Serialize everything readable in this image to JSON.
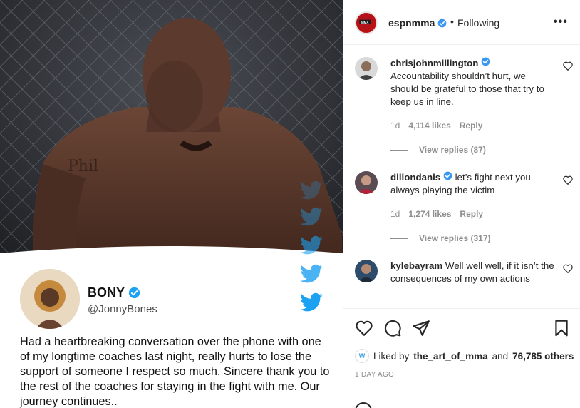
{
  "post": {
    "tweet": {
      "name": "BONY",
      "handle": "@JonnyBones",
      "text": "Had a heartbreaking conversation over the phone with one of my longtime coaches last night, really hurts to lose the support of someone I respect so much. Sincere thank you to the rest of the coaches for staying in the fight with me. Our journey continues.."
    }
  },
  "header": {
    "username": "espnmma",
    "separator": "•",
    "follow_status": "Following",
    "more": "•••"
  },
  "comments": [
    {
      "username": "chrisjohnmillington",
      "verified": true,
      "text": "Accountability shouldn’t hurt, we should be grateful to those that try to keep us in line.",
      "age": "1d",
      "likes": "4,114 likes",
      "reply": "Reply",
      "view_replies": "View replies (87)"
    },
    {
      "username": "dillondanis",
      "verified": true,
      "text": "let’s fight next you always playing the victim",
      "age": "1d",
      "likes": "1,274 likes",
      "reply": "Reply",
      "view_replies": "View replies (317)"
    },
    {
      "username": "kylebayram",
      "verified": false,
      "text": "Well well well, if it isn’t the consequences of my own actions"
    }
  ],
  "likes": {
    "prefix": "Liked by",
    "user": "the_art_of_mma",
    "and": "and",
    "others": "76,785 others"
  },
  "time_ago": "1 DAY AGO",
  "colors": {
    "verified": "#3897f0",
    "twitter_blue": "#1da1f2",
    "meta_gray": "#8e8e8e",
    "text": "#262626"
  }
}
